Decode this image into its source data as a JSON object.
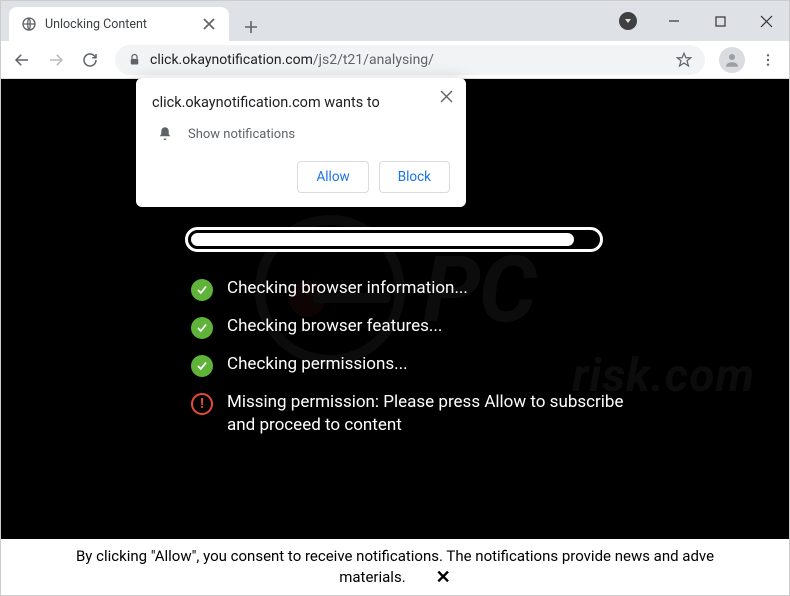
{
  "tab": {
    "title": "Unlocking Content"
  },
  "url": {
    "host": "click.okaynotification.com",
    "path": "/js2/t21/analysing/"
  },
  "notification": {
    "title": "click.okaynotification.com wants to",
    "subtitle": "Show notifications",
    "allow": "Allow",
    "block": "Block"
  },
  "checks": {
    "items": [
      {
        "status": "ok",
        "text": "Checking browser information..."
      },
      {
        "status": "ok",
        "text": "Checking browser features..."
      },
      {
        "status": "ok",
        "text": "Checking permissions..."
      },
      {
        "status": "err",
        "text": "Missing permission: Please press Allow to subscribe and proceed to content"
      }
    ]
  },
  "footer": {
    "line1": "By clicking \"Allow\", you consent to receive notifications. The notifications provide news and adve",
    "line2": "materials.",
    "close": "✕"
  },
  "watermark": {
    "text": "PC",
    "sub": "risk.com"
  }
}
